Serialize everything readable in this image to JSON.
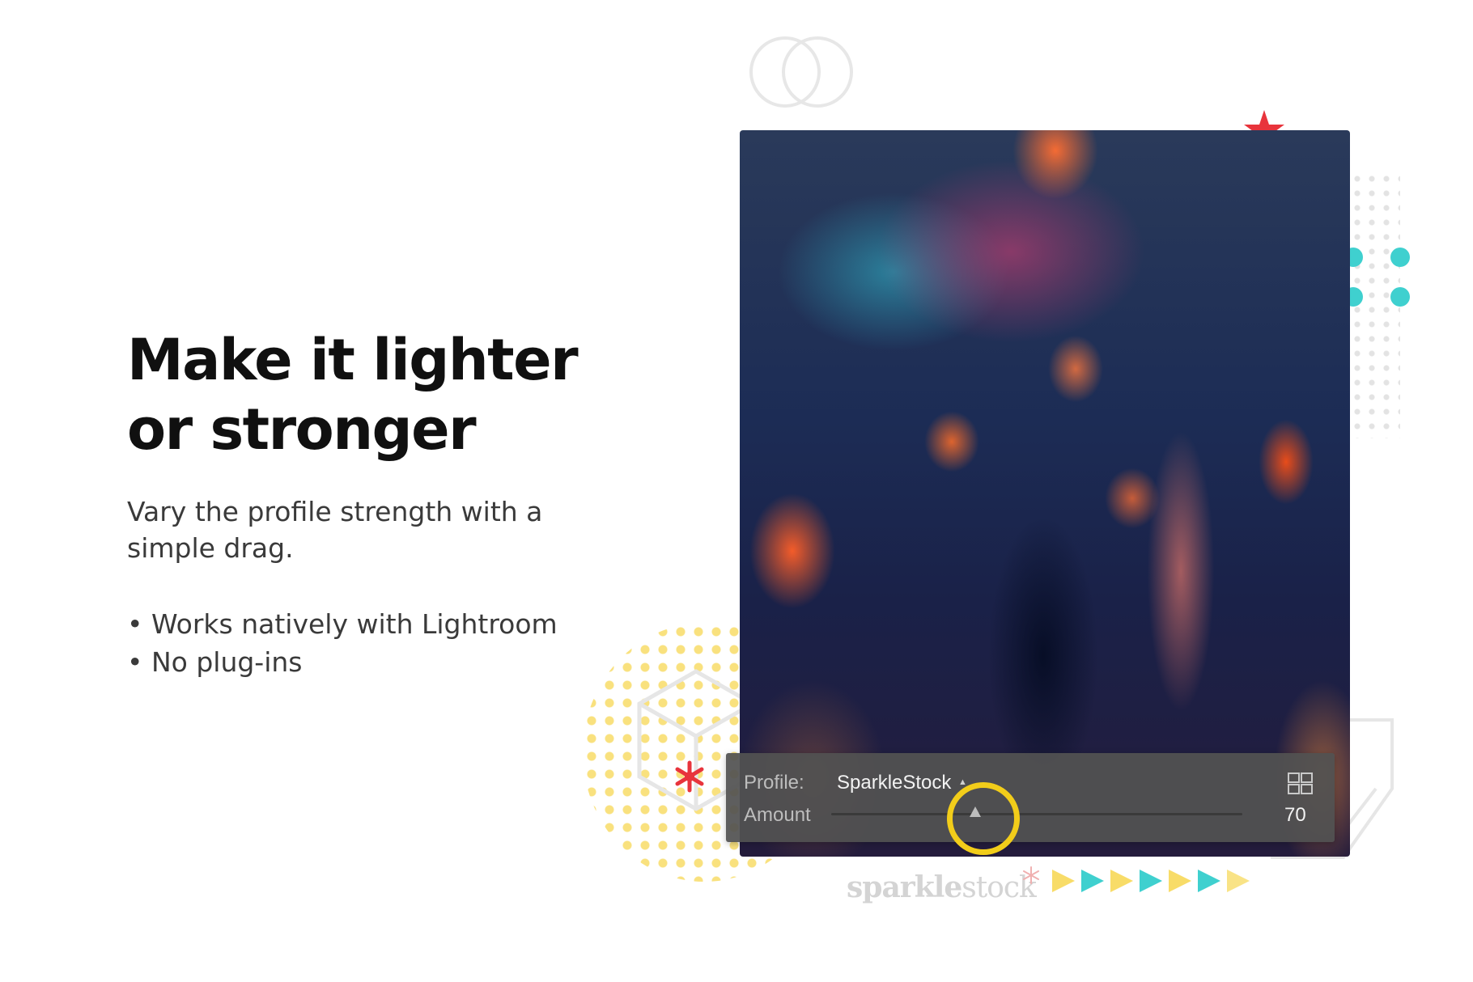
{
  "headline": [
    "Make it lighter",
    "or stronger"
  ],
  "subline": "Vary the profile strength with a simple drag.",
  "bullets": [
    "Works natively with Lightroom",
    "No plug-ins"
  ],
  "panel": {
    "profile_label": "Profile:",
    "profile_value": "SparkleStock",
    "amount_label": "Amount",
    "amount_value": "70",
    "slider_fraction": 0.35
  },
  "brand": {
    "bold": "sparkle",
    "light": "stock"
  },
  "colors": {
    "headline": "#101010",
    "body_text": "#3a3a3a",
    "panel_bg": "#525252",
    "highlight_ring": "#f2cd1a",
    "accent_red": "#e8343c",
    "accent_teal": "#3fd0cf",
    "accent_yellow": "#f8dc68",
    "brand_text": "#d4d4d4"
  },
  "icons": {
    "grid": "grid-view-icon",
    "dropdown": "dropdown-caret-icon",
    "star": "red-star-icon",
    "asterisk": "red-asterisk-icon"
  }
}
